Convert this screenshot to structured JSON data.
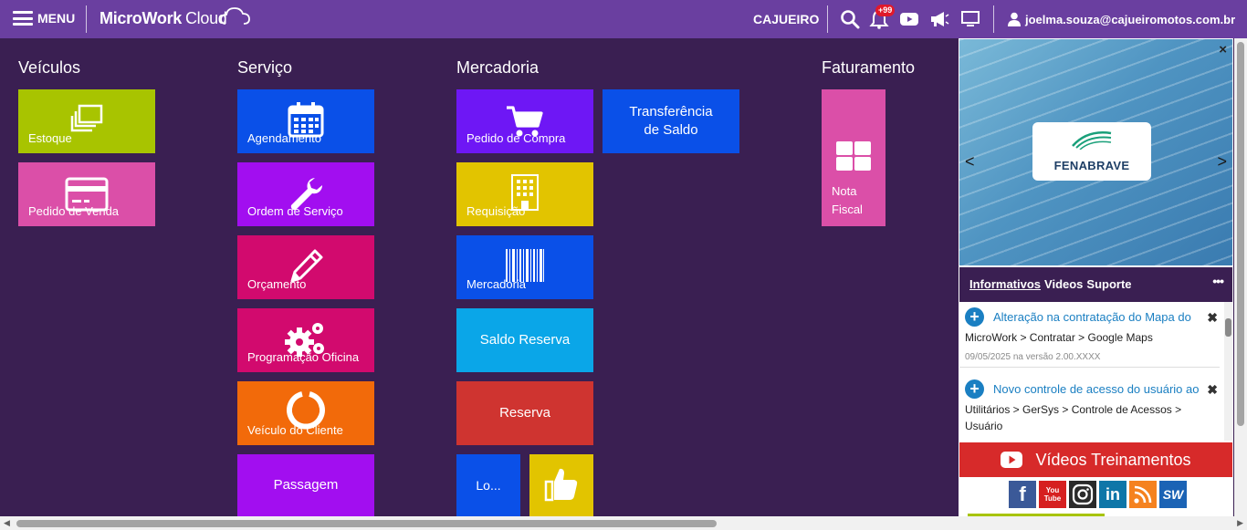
{
  "topbar": {
    "menu_label": "MENU",
    "logo_bold": "MicroWork",
    "logo_light": "Cloud",
    "company": "CAJUEIRO",
    "notif_badge": "+99",
    "user_email": "joelma.souza@cajueiromotos.com.br",
    "icons": [
      "search-icon",
      "bell-icon",
      "youtube-icon",
      "megaphone-icon",
      "monitor-icon",
      "user-icon"
    ]
  },
  "sections": {
    "veiculos": "Veículos",
    "servico": "Serviço",
    "mercadoria": "Mercadoria",
    "faturamento": "Faturamento"
  },
  "tiles": {
    "estoque": "Estoque",
    "pedido_venda": "Pedido de Venda",
    "agendamento": "Agendamento",
    "ordem_servico": "Ordem de Serviço",
    "orcamento": "Orçamento",
    "programacao_oficina": "Programação Oficina",
    "veiculo_cliente": "Veículo do Cliente",
    "passagem": "Passagem",
    "pedido_compra": "Pedido de Compra",
    "transferencia_saldo_l1": "Transferência",
    "transferencia_saldo_l2": "de Saldo",
    "requisicao": "Requisição",
    "mercadoria": "Mercadoria",
    "saldo_reserva": "Saldo Reserva",
    "reserva": "Reserva",
    "lo": "Lo...",
    "nota_fiscal_l1": "Nota",
    "nota_fiscal_l2": "Fiscal"
  },
  "colors": {
    "topbar": "#6a3fa0",
    "background": "#3a1f52",
    "green": "#a8c400",
    "pink": "#db4fa8",
    "blue": "#0a50e8",
    "purple": "#a20ef0",
    "magenta": "#d20a6e",
    "orange": "#f26a0a",
    "violet": "#6e17f5",
    "yellow": "#e2c400",
    "cyan": "#0aa6e8",
    "red": "#cf3430",
    "videos_red": "#d72a2a"
  },
  "panel": {
    "banner_logo": "FENABRAVE",
    "close": "×",
    "prev": "<",
    "next": ">",
    "tab_informativos": "Informativos",
    "tab_videos": "Videos",
    "tab_suporte": "Suporte",
    "more": "•••",
    "news": [
      {
        "title": "Alteração na contratação do Mapa do",
        "path": "MicroWork > Contratar > Google Maps",
        "date": "09/05/2025 na versão 2.00.XXXX"
      },
      {
        "title": "Novo controle de acesso do usuário ao",
        "path": "Utilitários > GerSys > Controle de Acessos > Usuário",
        "date": ""
      }
    ],
    "videos_label": "Vídeos Treinamentos",
    "social": [
      {
        "name": "facebook-icon",
        "glyph": "f",
        "color": "#3b5998"
      },
      {
        "name": "youtube-icon",
        "glyph": "You Tube",
        "color": "#d62020"
      },
      {
        "name": "instagram-icon",
        "glyph": "◎",
        "color": "#2a2a2a"
      },
      {
        "name": "linkedin-icon",
        "glyph": "in",
        "color": "#0e76a8"
      },
      {
        "name": "rss-icon",
        "glyph": "))",
        "color": "#f5821f"
      },
      {
        "name": "sw-icon",
        "glyph": "SW",
        "color": "#1b63b5"
      }
    ]
  }
}
